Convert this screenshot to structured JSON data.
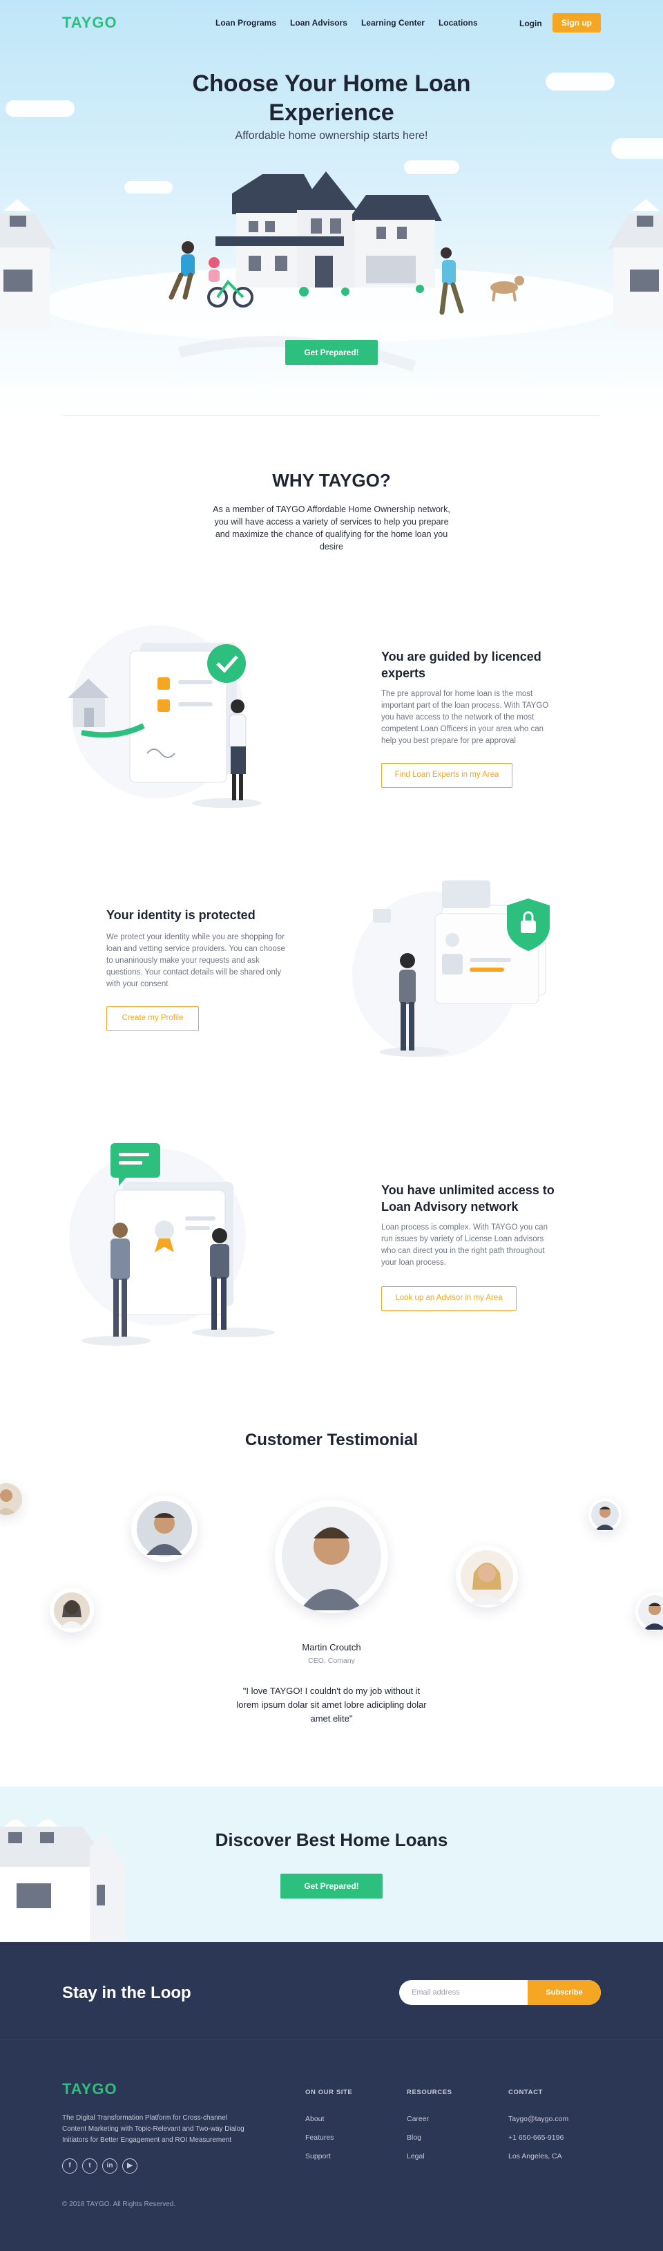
{
  "brand": {
    "logo": "TAYGO",
    "green": "#2dbf7e",
    "orange": "#f5a623",
    "navy": "#2c3655"
  },
  "nav": {
    "links": [
      "Loan Programs",
      "Loan Advisors",
      "Learning Center",
      "Locations"
    ],
    "login": "Login",
    "signup": "Sign up"
  },
  "hero": {
    "title_line1": "Choose Your Home Loan",
    "title_line2": "Experience",
    "subtitle": "Affordable home ownership starts here!",
    "cta": "Get Prepared!"
  },
  "why": {
    "title": "WHY TAYGO?",
    "text": "As a member of TAYGO Affordable Home Ownership network, you will have access a variety of services to help you prepare and maximize the chance of qualifying for the home loan you desire"
  },
  "features": [
    {
      "title": "You are guided by licenced experts",
      "text": "The pre approval for home loan is the most important part of the loan process. With TAYGO you have access to the network of the most competent Loan Officers in your area who can help you best prepare for pre approval",
      "button": "Find Loan Experts in my Area",
      "icon": "checkmark-document-icon"
    },
    {
      "title": "Your identity is protected",
      "text": "We protect your identity while you are shopping for loan and vetting service providers. You can choose to unaninously make your requests and ask questions. Your contact details will be shared only with your consent",
      "button": "Create my Profile",
      "icon": "shield-lock-icon"
    },
    {
      "title": "You have unlimited access to Loan Advisory network",
      "text": "Loan process is complex. With TAYGO you can run issues by variety of License Loan advisors who can direct you in the right path throughout your loan process.",
      "button": "Look up an Advisor in my Area",
      "icon": "chat-certificate-icon"
    }
  ],
  "testimonial": {
    "title": "Customer Testimonial",
    "name": "Martin Croutch",
    "role": "CEO, Comany",
    "quote": "\"I love TAYGO! I couldn't do my job without it lorem ipsum dolar sit amet lobre adicipling dolar amet elite\""
  },
  "discover": {
    "title": "Discover Best Home Loans",
    "cta": "Get Prepared!"
  },
  "footer": {
    "loop_title": "Stay in the Loop",
    "email_placeholder": "Email address",
    "subscribe": "Subscribe",
    "logo": "TAYGO",
    "description": "The Digital Transformation Platform for Cross-channel Content Marketing with Topic-Relevant and Two-way Dialog Initiators for Better Engagement and ROI Measurement",
    "socials": [
      "facebook-icon",
      "twitter-icon",
      "linkedin-icon",
      "youtube-icon"
    ],
    "columns": [
      {
        "heading": "ON OUR SITE",
        "items": [
          "About",
          "Features",
          "Support"
        ]
      },
      {
        "heading": "RESOURCES",
        "items": [
          "Career",
          "Blog",
          "Legal"
        ]
      },
      {
        "heading": "CONTACT",
        "items": [
          "Taygo@taygo.com",
          "+1 650-665-9196",
          "Los Angeles, CA"
        ]
      }
    ],
    "copyright": "© 2018 TAYGO. All Rights Reserved."
  }
}
